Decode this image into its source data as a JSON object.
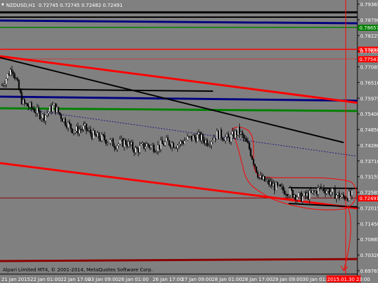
{
  "header": {
    "title": "NZDUSD,H1",
    "ohlc": "0.72745 0.72745 0.72482 0.72491"
  },
  "copyright": "Alpari Limited MT4, © 2001-2014, MetaQuotes Software Corp.",
  "colors": {
    "background": "#808080",
    "candle": "#000000",
    "red_line": "#ff0000",
    "blue_line": "#000080",
    "green_line": "#008000",
    "black_line": "#000000",
    "dark_red_line": "#8b0000",
    "axis_text": "#ffffff",
    "price_label_bg": "#ff0000",
    "price_label_green_bg": "#008000"
  },
  "chart_data": {
    "type": "candlestick",
    "symbol": "NZDUSD",
    "timeframe": "H1",
    "y_ticks": [
      "0.79365",
      "0.78790",
      "0.78225",
      "0.77655",
      "0.77085",
      "0.76510",
      "0.75975",
      "0.75400",
      "0.74850",
      "0.74280",
      "0.73710",
      "0.73155",
      "0.72585",
      "0.72015",
      "0.71450",
      "0.70885",
      "0.70320",
      "0.69765"
    ],
    "x_ticks": [
      "21 Jan 2015",
      "22 Jan 01:00",
      "22 Jan 17:00",
      "23 Jan 09:00",
      "26 Jan 01:00",
      "26 Jan 17:00",
      "27 Jan 09:00",
      "28 Jan 01:00",
      "28 Jan 17:00",
      "29 Jan 09:00",
      "30 Jan 01:00",
      "2015.01.30 23:00"
    ],
    "price_labels": [
      {
        "text": "0.78657",
        "color": "green"
      },
      {
        "text": "0.77890",
        "color": "red"
      },
      {
        "text": "0.77543",
        "color": "red"
      },
      {
        "text": "0.72491",
        "color": "red"
      }
    ],
    "ylim": [
      0.69765,
      0.79365
    ],
    "close_path": [
      0.7645,
      0.771,
      0.758,
      0.756,
      0.753,
      0.757,
      0.752,
      0.748,
      0.749,
      0.746,
      0.745,
      0.743,
      0.744,
      0.741,
      0.743,
      0.742,
      0.744,
      0.743,
      0.745,
      0.746,
      0.744,
      0.747,
      0.745,
      0.748,
      0.742,
      0.731,
      0.729,
      0.727,
      0.726,
      0.724,
      0.725,
      0.7275,
      0.726,
      0.724,
      0.7249
    ]
  }
}
